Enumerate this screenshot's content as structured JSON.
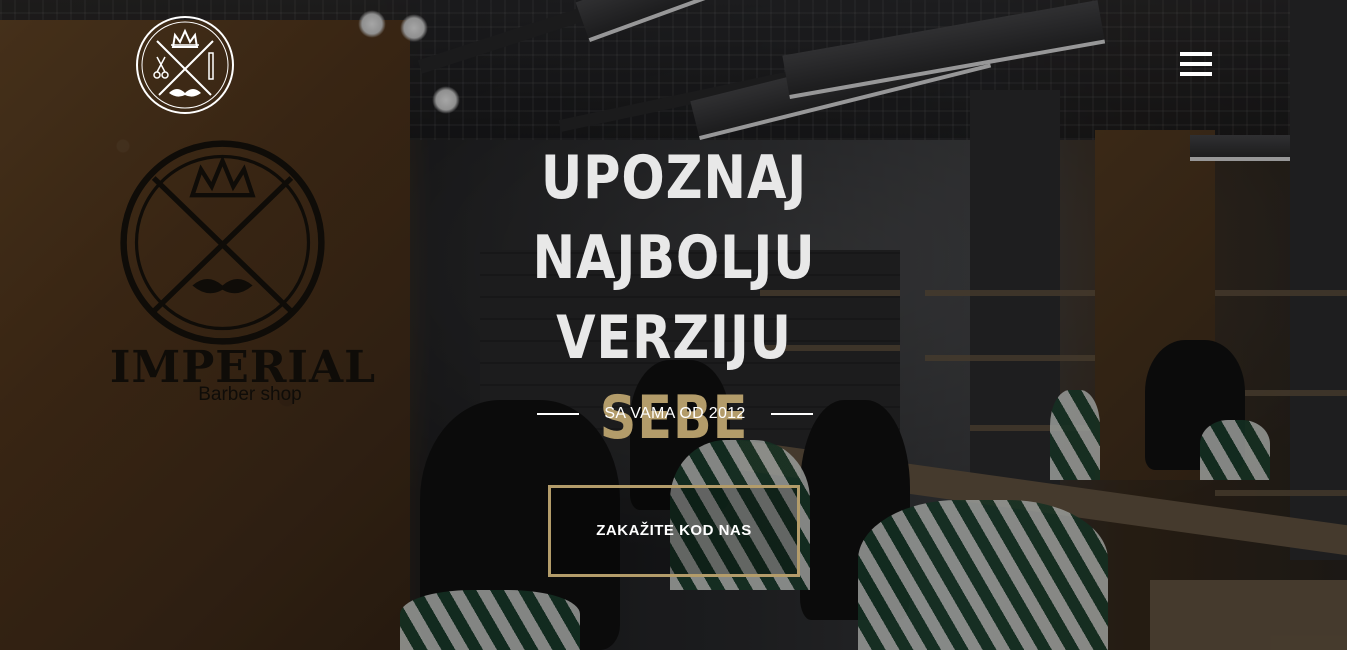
{
  "header": {
    "logo_icon": "imperial-barber-crest-icon",
    "menu_icon": "hamburger-menu-icon"
  },
  "wall_sign": {
    "brand": "IMPERIAL",
    "sub": "Barber shop"
  },
  "hero": {
    "headline_line1": "UPOZNAJ",
    "headline_line2": "NAJBOLJU VERZIJU",
    "headline_line3": "SEBE",
    "tagline": "SA VAMA OD 2012",
    "cta_label": "ZAKAŽITE KOD NAS"
  },
  "colors": {
    "accent_gold": "#b39c6a",
    "headline_text": "#e8e8e8",
    "white": "#ffffff"
  }
}
